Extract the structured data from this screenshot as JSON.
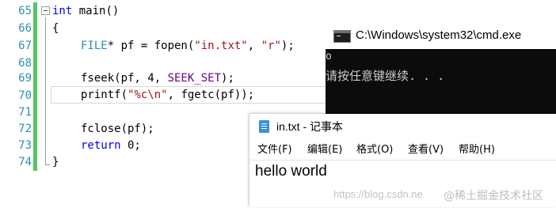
{
  "editor": {
    "line_numbers": [
      "65",
      "66",
      "67",
      "68",
      "69",
      "70",
      "71",
      "72",
      "73",
      "74"
    ],
    "lines": {
      "l65_kw": "int",
      "l65_rest": " main()",
      "l66": "{",
      "l67_type": "FILE",
      "l67_a": "* pf = fopen(",
      "l67_s1": "\"in.txt\"",
      "l67_b": ", ",
      "l67_s2": "\"r\"",
      "l67_c": ");",
      "l69_a": "fseek(pf, 4, ",
      "l69_macro": "SEEK_SET",
      "l69_b": ");",
      "l70_a": "printf(",
      "l70_s": "\"%c\\n\"",
      "l70_b": ", fgetc(pf));",
      "l72": "fclose(pf);",
      "l73_kw": "return",
      "l73_rest": " 0;",
      "l74": "}"
    },
    "colors": {
      "keyword": "#0000ff",
      "type": "#2b91af",
      "string": "#a31515",
      "macro": "#6f008a",
      "change_bar": "#5cc261"
    }
  },
  "cmd": {
    "title": "C:\\Windows\\system32\\cmd.exe",
    "output_line1": "o",
    "output_line2": "请按任意键继续. . ."
  },
  "notepad": {
    "title": "in.txt - 记事本",
    "menus": [
      "文件(F)",
      "编辑(E)",
      "格式(O)",
      "查看(V)",
      "帮助(H)"
    ],
    "content": "hello world",
    "watermark_url": "https://blog.csdn.ne",
    "watermark_brand": "@稀土掘金技术社区"
  }
}
